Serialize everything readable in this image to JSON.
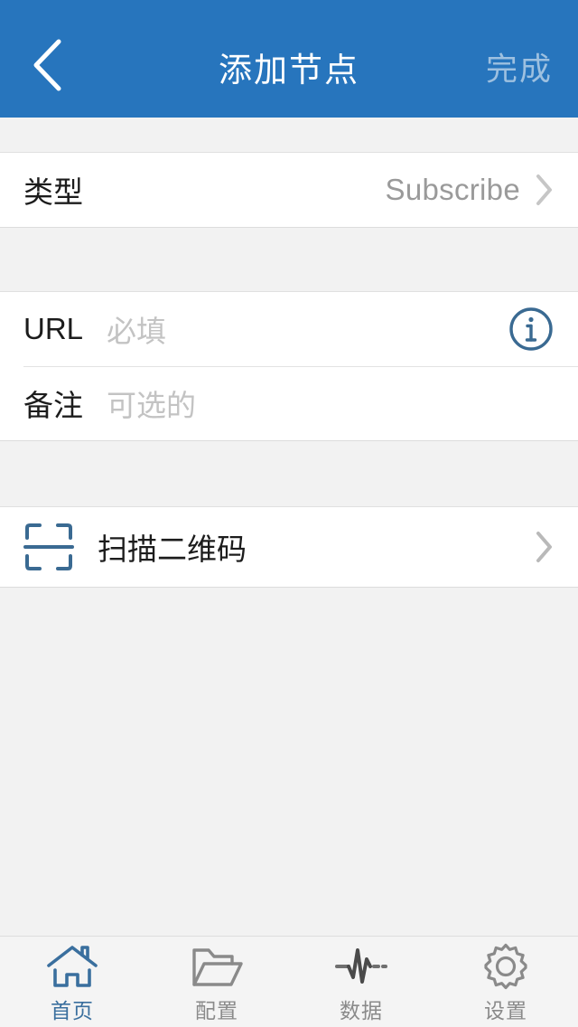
{
  "colors": {
    "header_blue": "#2775bd",
    "accent_steel_blue": "#3a6a92",
    "page_background": "#f2f2f2",
    "card_background": "#ffffff",
    "placeholder_gray": "#c3c3c3",
    "value_gray": "#9a9a9a",
    "done_disabled": "#9dc0e0",
    "tab_inactive": "#8a8a8a",
    "tab_active": "#3a6f9e"
  },
  "header": {
    "back_icon": "chevron-left-icon",
    "title": "添加节点",
    "done_label": "完成"
  },
  "sections": {
    "type": {
      "label": "类型",
      "value": "Subscribe",
      "chevron_icon": "chevron-right-icon"
    },
    "fields": [
      {
        "label": "URL",
        "placeholder": "必填",
        "trailing_icon": "info-circle-icon"
      },
      {
        "label": "备注",
        "placeholder": "可选的",
        "trailing_icon": ""
      }
    ],
    "scan": {
      "icon": "qr-scan-icon",
      "label": "扫描二维码",
      "chevron_icon": "chevron-right-icon"
    }
  },
  "tabbar": {
    "items": [
      {
        "label": "首页",
        "icon": "home-icon",
        "active": true
      },
      {
        "label": "配置",
        "icon": "folder-icon",
        "active": false
      },
      {
        "label": "数据",
        "icon": "pulse-icon",
        "active": false
      },
      {
        "label": "设置",
        "icon": "gear-icon",
        "active": false
      }
    ]
  }
}
